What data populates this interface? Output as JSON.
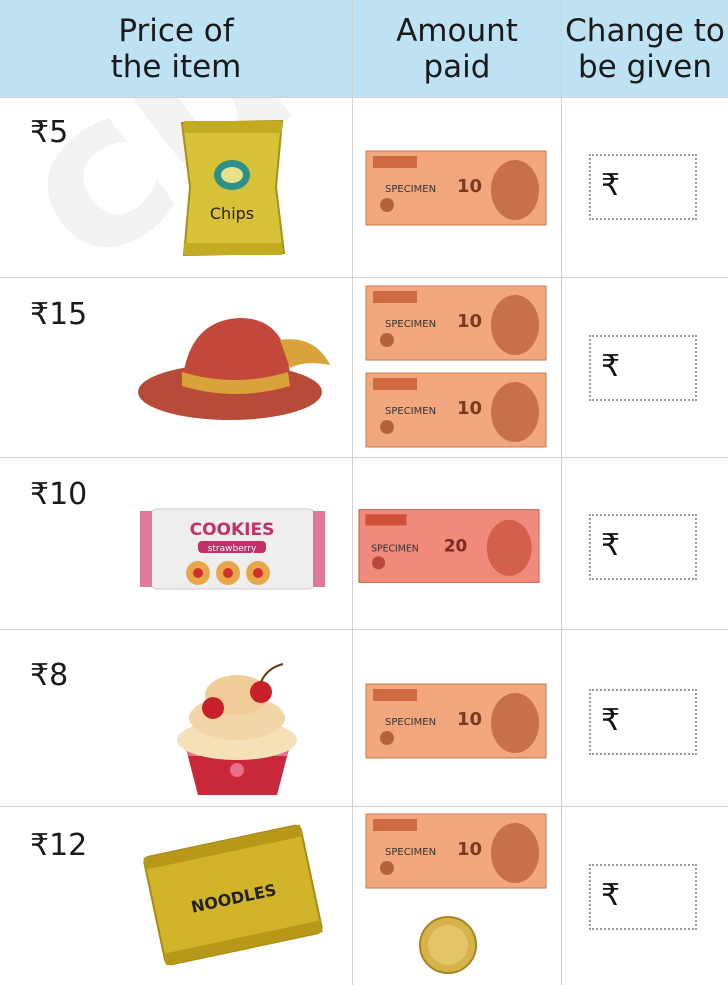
{
  "table": {
    "headers": {
      "price": [
        "Price of",
        "the item"
      ],
      "paid": [
        "Amount",
        "paid"
      ],
      "change": [
        "Change to",
        "be given"
      ]
    },
    "rows": [
      {
        "price": "₹5",
        "item": "chips packet",
        "item_label": "Chips",
        "paid": [
          "10 rupee note"
        ],
        "change_symbol": "₹"
      },
      {
        "price": "₹15",
        "item": "hat",
        "item_label": "",
        "paid": [
          "10 rupee note",
          "10 rupee note"
        ],
        "change_symbol": "₹"
      },
      {
        "price": "₹10",
        "item": "cookies packet",
        "item_label": "COOKIES",
        "item_sublabel": "strawberry",
        "paid": [
          "20 rupee note"
        ],
        "change_symbol": "₹"
      },
      {
        "price": "₹8",
        "item": "cupcake",
        "item_label": "",
        "paid": [
          "10 rupee note"
        ],
        "change_symbol": "₹"
      },
      {
        "price": "₹12",
        "item": "noodles packet",
        "item_label": "NOODLES",
        "paid": [
          "10 rupee note",
          "5 rupee coin"
        ],
        "change_symbol": "₹"
      }
    ]
  },
  "note_text": {
    "specimen": "SPECIMEN",
    "ten": "10",
    "twenty": "20"
  },
  "colors": {
    "header_bg": "#bfe3f2",
    "note10": "#f2a77e",
    "note20": "#f08a7a",
    "coin": "#d8b24a"
  }
}
